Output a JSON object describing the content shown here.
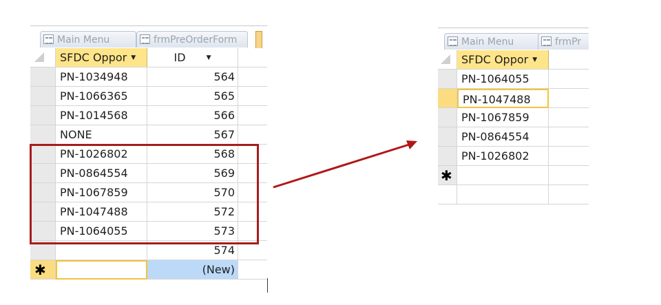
{
  "left": {
    "tabs": [
      {
        "label": "Main Menu"
      },
      {
        "label": "frmPreOrderForm"
      }
    ],
    "columns": {
      "sfdc": "SFDC Oppor",
      "id": "ID"
    },
    "rows": [
      {
        "sfdc": "PN-1034948",
        "id": "564"
      },
      {
        "sfdc": "PN-1066365",
        "id": "565"
      },
      {
        "sfdc": "PN-1014568",
        "id": "566"
      },
      {
        "sfdc": "NONE",
        "id": "567"
      },
      {
        "sfdc": "PN-1026802",
        "id": "568"
      },
      {
        "sfdc": "PN-0864554",
        "id": "569"
      },
      {
        "sfdc": "PN-1067859",
        "id": "570"
      },
      {
        "sfdc": "PN-1047488",
        "id": "572"
      },
      {
        "sfdc": "PN-1064055",
        "id": "573"
      },
      {
        "sfdc": "",
        "id": "574"
      }
    ],
    "new_row": {
      "marker": "✱",
      "id": "(New)"
    }
  },
  "right": {
    "tabs": [
      {
        "label": "Main Menu"
      },
      {
        "label": "frmPr"
      }
    ],
    "columns": {
      "sfdc": "SFDC Oppor"
    },
    "rows": [
      {
        "sfdc": "PN-1064055"
      },
      {
        "sfdc": "PN-1047488"
      },
      {
        "sfdc": "PN-1067859"
      },
      {
        "sfdc": "PN-0864554"
      },
      {
        "sfdc": "PN-1026802"
      }
    ],
    "new_row": {
      "marker": "✱"
    }
  },
  "colors": {
    "highlight_box": "#a61c1c",
    "arrow": "#b01818",
    "header": "#ffe58a",
    "new_id": "#bcd9f7"
  }
}
